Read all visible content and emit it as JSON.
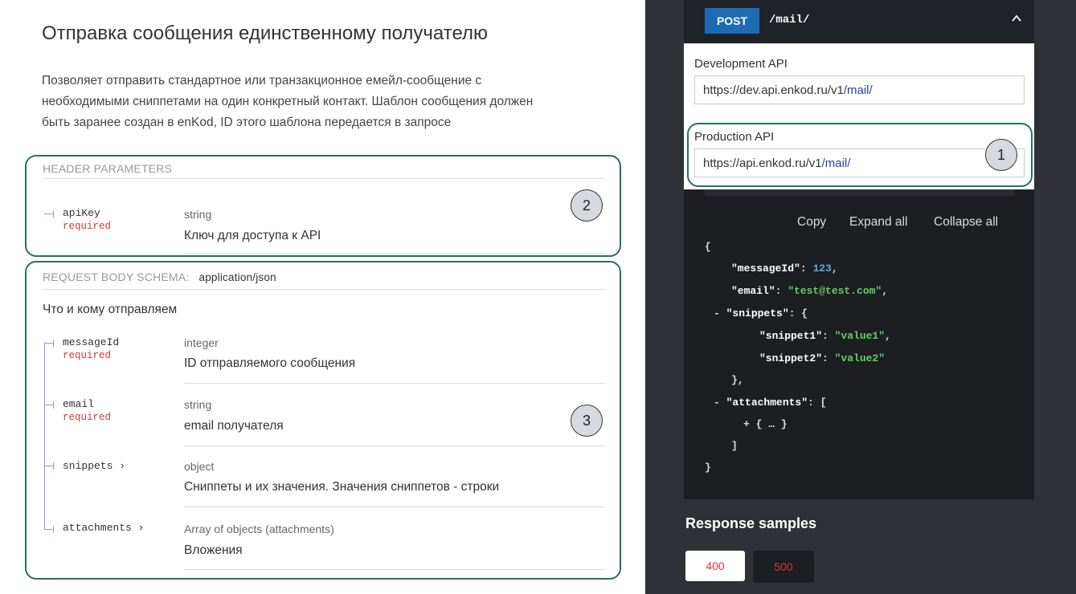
{
  "endpoint": {
    "title": "Отправка сообщения единственному получателю",
    "description_lines": [
      "Позволяет отправить стандартное или транзакционное емейл-сообщение с",
      "необходимыми сниппетами на один конкретный контакт. Шаблон сообщения должен",
      "быть заранее создан в enKod, ID этого шаблона передается в запросе"
    ]
  },
  "header_params": {
    "heading": "HEADER PARAMETERS",
    "items": [
      {
        "name": "apiKey",
        "required": "required",
        "type": "string",
        "desc": "Ключ для доступа к API"
      }
    ]
  },
  "request_body": {
    "heading": "REQUEST BODY SCHEMA:",
    "content_type": "application/json",
    "subtitle": "Что и кому отправляем",
    "items": [
      {
        "name": "messageId",
        "required": "required",
        "type": "integer",
        "desc": "ID отправляемого сообщения"
      },
      {
        "name": "email",
        "required": "required",
        "type": "string",
        "desc": "email получателя"
      },
      {
        "name": "snippets ›",
        "required": "",
        "type": "object",
        "desc": "Сниппеты и их значения. Значения сниппетов - строки"
      },
      {
        "name": "attachments ›",
        "required": "",
        "type": "Array of objects (attachments)",
        "desc": "Вложения"
      }
    ]
  },
  "annotations": [
    "1",
    "2",
    "3"
  ],
  "request_panel": {
    "method": "POST",
    "path": "/mail/",
    "servers": [
      {
        "label": "Development API",
        "base": "https://dev.api.enkod.ru/v1",
        "path": "/mail/"
      },
      {
        "label": "Production API",
        "base": "https://api.enkod.ru/v1",
        "path": "/mail/"
      }
    ],
    "code_actions": {
      "copy": "Copy",
      "expand": "Expand all",
      "collapse": "Collapse all"
    }
  },
  "code_sample": {
    "lines": [
      "{",
      "\"messageId\": 123,",
      "\"email\": \"test@test.com\",",
      "- \"snippets\": {",
      "\"snippet1\": \"value1\",",
      "\"snippet2\": \"value2\"",
      "},",
      "- \"attachments\": [",
      "+ { … }",
      "]",
      "}"
    ]
  },
  "response_samples": {
    "title": "Response samples",
    "codes": [
      "400",
      "500"
    ]
  },
  "colors": {
    "annotation_border": "#2a6f62",
    "post_badge": "#1d6bb5",
    "required": "#d03a3a",
    "code_number": "#5aa7e6",
    "code_string": "#5fd066"
  }
}
